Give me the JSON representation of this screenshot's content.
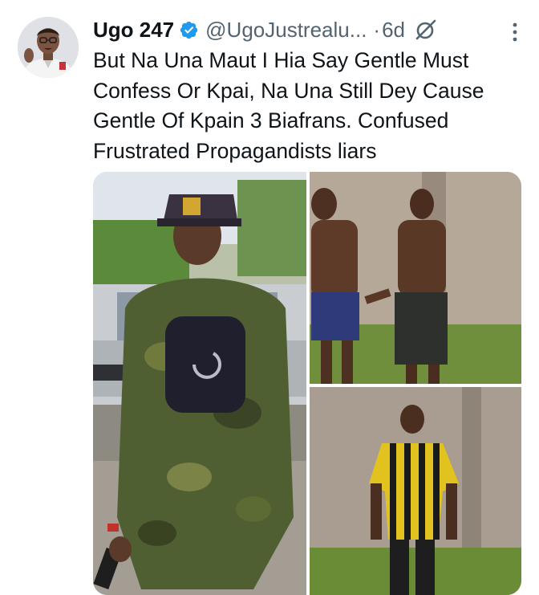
{
  "tweet": {
    "display_name": "Ugo 247",
    "handle": "@UgoJustrealu...",
    "separator": "·",
    "timestamp": "6d",
    "text": "But Na Una Maut I Hia Say Gentle Must Confess Or Kpai, Na Una Still Dey Cause Gentle Of Kpain 3 Biafrans.  Confused Frustrated Propagandists liars"
  },
  "icons": {
    "verified": "verified-badge-icon",
    "grok": "grok-icon",
    "more": "more-options-icon"
  },
  "colors": {
    "text_primary": "#0f1419",
    "text_secondary": "#536471",
    "verified_blue": "#1d9bf0"
  },
  "media": {
    "photo_count": 3
  }
}
